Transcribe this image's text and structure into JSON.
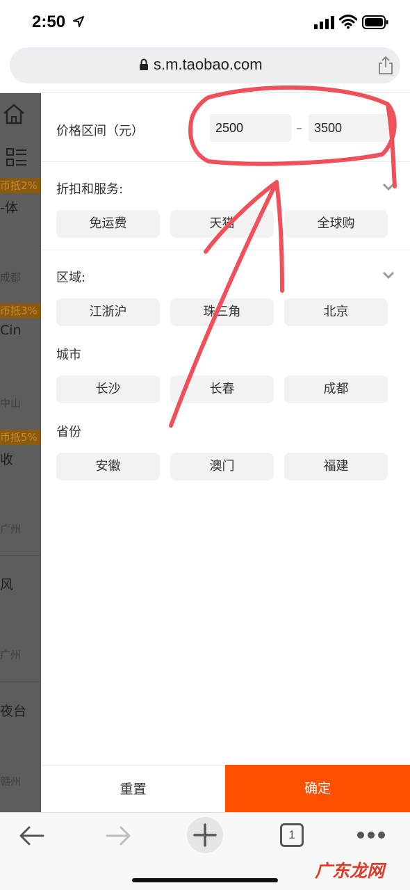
{
  "status_bar": {
    "time": "2:50"
  },
  "browser": {
    "url": "s.m.taobao.com",
    "tab_count": "1"
  },
  "background_list": {
    "badges": [
      "币抵2%",
      "币抵3%",
      "币抵5%"
    ],
    "titles": [
      "-体",
      "Cin",
      "收",
      "风",
      "夜台"
    ],
    "cities": [
      "成都",
      "中山",
      "广州",
      "广州",
      "赣州"
    ]
  },
  "filter": {
    "price": {
      "label": "价格区间（元）",
      "min": "2500",
      "max": "3500",
      "separator": "–"
    },
    "services": {
      "label": "折扣和服务:",
      "options": [
        "免运费",
        "天猫",
        "全球购"
      ]
    },
    "region": {
      "label": "区域:",
      "options": [
        "江浙沪",
        "珠三角",
        "北京"
      ],
      "city_label": "城市",
      "city_options": [
        "长沙",
        "长春",
        "成都"
      ],
      "province_label": "省份",
      "province_options": [
        "安徽",
        "澳门",
        "福建"
      ]
    },
    "reset_label": "重置",
    "confirm_label": "确定"
  },
  "colors": {
    "accent": "#ff5000",
    "annotation": "#f0505a"
  },
  "watermark": "广东龙网"
}
